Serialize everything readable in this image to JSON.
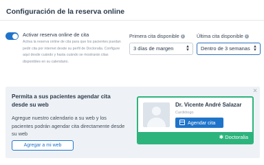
{
  "header": {
    "title": "Configuración de la reserva online"
  },
  "online_booking": {
    "label": "Activar reserva online de cita",
    "description": "Activa la reserva online de cita para que los pacientes puedan pedir cita por internet desde su perfil de Doctoralia. Configure aquí desde cuándo y hasta cuándo se mostrarán citas disponibles en su calendario.",
    "enabled": true
  },
  "first_available": {
    "label": "Primera cita disponible",
    "value": "3 días de margen"
  },
  "last_available": {
    "label": "Última cita disponible",
    "value": "Dentro de 3 semanas"
  },
  "promo": {
    "title": "Permita a sus pacientes agendar cita desde su web",
    "description": "Agregue nuestro calendario a su web y los pacientes podrán agendar cita directamente desde su web",
    "button_label": "Agregar a mi web",
    "close_symbol": "×"
  },
  "widget_preview": {
    "doctor_name": "Dr. Vicente André Salazar",
    "specialty": "Cardiólogo",
    "button_label": "Agendar cita",
    "brand": "Doctoralia"
  },
  "icons": {
    "info": "i",
    "chevron": "▲▼",
    "brand_star": "✱"
  },
  "colors": {
    "accent": "#1f74c9",
    "brand_green": "#2db37c",
    "promo_bg": "#eef2f6"
  }
}
